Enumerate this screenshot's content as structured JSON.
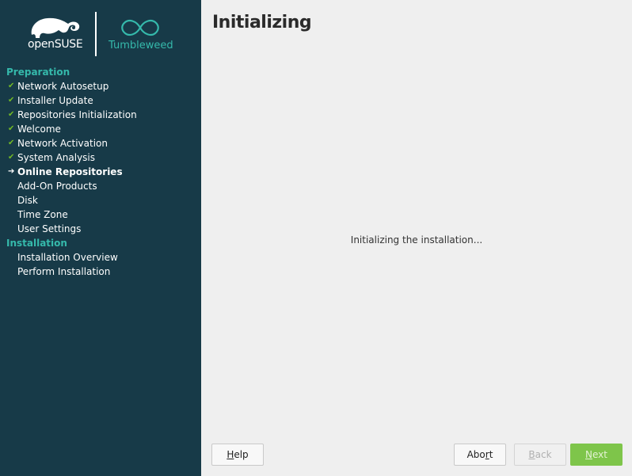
{
  "app": {
    "brand": "openSUSE",
    "distro_name": "Tumbleweed"
  },
  "sidebar": {
    "groups": [
      {
        "heading": "Preparation",
        "items": [
          {
            "label": "Network Autosetup",
            "status": "done"
          },
          {
            "label": "Installer Update",
            "status": "done"
          },
          {
            "label": "Repositories Initialization",
            "status": "done"
          },
          {
            "label": "Welcome",
            "status": "done"
          },
          {
            "label": "Network Activation",
            "status": "done"
          },
          {
            "label": "System Analysis",
            "status": "done"
          },
          {
            "label": "Online Repositories",
            "status": "current"
          },
          {
            "label": "Add-On Products",
            "status": "pending"
          },
          {
            "label": "Disk",
            "status": "pending"
          },
          {
            "label": "Time Zone",
            "status": "pending"
          },
          {
            "label": "User Settings",
            "status": "pending"
          }
        ]
      },
      {
        "heading": "Installation",
        "items": [
          {
            "label": "Installation Overview",
            "status": "pending"
          },
          {
            "label": "Perform Installation",
            "status": "pending"
          }
        ]
      }
    ]
  },
  "main": {
    "title": "Initializing",
    "message": "Initializing the installation..."
  },
  "buttons": {
    "help": {
      "hotkey": "H",
      "rest": "elp",
      "enabled": true
    },
    "abort": {
      "before": "Abo",
      "hotkey": "r",
      "after": "t",
      "enabled": true
    },
    "back": {
      "hotkey": "B",
      "rest": "ack",
      "enabled": false
    },
    "next": {
      "hotkey": "N",
      "rest": "ext",
      "enabled": false
    }
  },
  "colors": {
    "sidebar_bg": "#173a48",
    "accent": "#35b9ab",
    "check": "#73ba25",
    "next_button": "#7ec54a"
  },
  "icons": {
    "done": "check-icon",
    "current": "arrow-right-icon"
  }
}
